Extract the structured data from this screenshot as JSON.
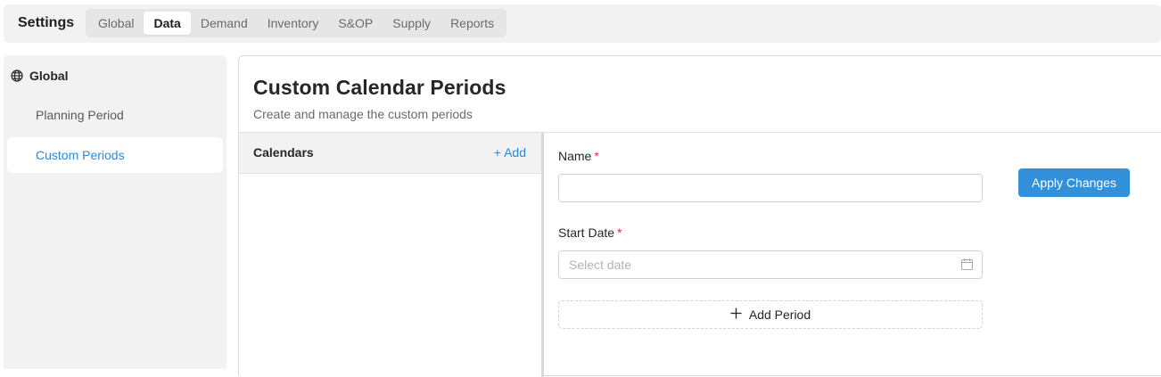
{
  "header": {
    "title": "Settings",
    "tabs": [
      {
        "label": "Global",
        "active": false
      },
      {
        "label": "Data",
        "active": true
      },
      {
        "label": "Demand",
        "active": false
      },
      {
        "label": "Inventory",
        "active": false
      },
      {
        "label": "S&OP",
        "active": false
      },
      {
        "label": "Supply",
        "active": false
      },
      {
        "label": "Reports",
        "active": false
      }
    ]
  },
  "sidebar": {
    "group": {
      "label": "Global",
      "icon": "globe-icon"
    },
    "items": [
      {
        "label": "Planning Period",
        "active": false
      },
      {
        "label": "Custom Periods",
        "active": true
      }
    ]
  },
  "main": {
    "title": "Custom Calendar Periods",
    "subtitle": "Create and manage the custom periods",
    "calendars": {
      "header": "Calendars",
      "add_label": "+ Add",
      "items": []
    },
    "form": {
      "name_label": "Name",
      "name_value": "",
      "start_date_label": "Start Date",
      "required_marker": "*",
      "start_date_placeholder": "Select date",
      "start_date_icon": "calendar-icon",
      "add_period_label": "Add Period",
      "add_period_icon": "plus-icon",
      "apply_label": "Apply Changes"
    }
  },
  "colors": {
    "accent": "#2b8ad6",
    "primary_button": "#3391dc",
    "required": "#e0333a"
  }
}
